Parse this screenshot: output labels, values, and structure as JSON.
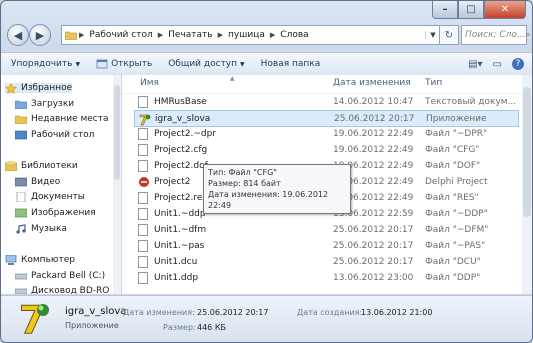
{
  "window": {
    "breadcrumb": [
      "Рабочий стол",
      "Печатать",
      "пушица",
      "Слова"
    ],
    "search_placeholder": "Поиск: Сло..."
  },
  "toolbar": {
    "organize": "Упорядочить",
    "open": "Открыть",
    "share": "Общий доступ",
    "new_folder": "Новая папка"
  },
  "nav": {
    "favorites": "Избранное",
    "downloads": "Загрузки",
    "recent": "Недавние места",
    "desktop": "Рабочий стол",
    "libraries": "Библиотеки",
    "video": "Видео",
    "documents": "Документы",
    "pictures": "Изображения",
    "music": "Музыка",
    "computer": "Компьютер",
    "drive_c": "Packard Bell (C:)",
    "drive_bd": "Дисковод BD-RO"
  },
  "columns": {
    "name": "Имя",
    "date": "Дата изменения",
    "type": "Тип"
  },
  "files": [
    {
      "name": "HMRusBase",
      "date": "14.06.2012 10:47",
      "type": "Текстовый докум..."
    },
    {
      "name": "igra_v_slova",
      "date": "25.06.2012 20:17",
      "type": "Приложение"
    },
    {
      "name": "Project2.~dpr",
      "date": "19.06.2012 22:49",
      "type": "Файл \"~DPR\""
    },
    {
      "name": "Project2.cfg",
      "date": "19.06.2012 22:49",
      "type": "Файл \"CFG\""
    },
    {
      "name": "Project2.dof",
      "date": "19.06.2012 22:49",
      "type": "Файл \"DOF\""
    },
    {
      "name": "Project2",
      "date": "19.06.2012 22:49",
      "type": "Delphi Project"
    },
    {
      "name": "Project2.res",
      "date": "19.06.2012 22:49",
      "type": "Файл \"RES\""
    },
    {
      "name": "Unit1.~ddp",
      "date": "13.06.2012 22:59",
      "type": "Файл \"~DDP\""
    },
    {
      "name": "Unit1.~dfm",
      "date": "25.06.2012 20:17",
      "type": "Файл \"~DFM\""
    },
    {
      "name": "Unit1.~pas",
      "date": "25.06.2012 20:17",
      "type": "Файл \"~PAS\""
    },
    {
      "name": "Unit1.dcu",
      "date": "25.06.2012 20:17",
      "type": "Файл \"DCU\""
    },
    {
      "name": "Unit1.ddp",
      "date": "13.06.2012 23:00",
      "type": "Файл \"DDP\""
    }
  ],
  "tooltip": {
    "line1": "Тип: Файл \"CFG\"",
    "line2": "Размер: 814 байт",
    "line3": "Дата изменения: 19.06.2012 22:49"
  },
  "details": {
    "name": "igra_v_slova",
    "type": "Приложение",
    "modified_label": "Дата изменения:",
    "modified_value": "25.06.2012 20:17",
    "created_label": "Дата создания:",
    "created_value": "13.06.2012 21:00",
    "size_label": "Размер:",
    "size_value": "446 КБ"
  }
}
